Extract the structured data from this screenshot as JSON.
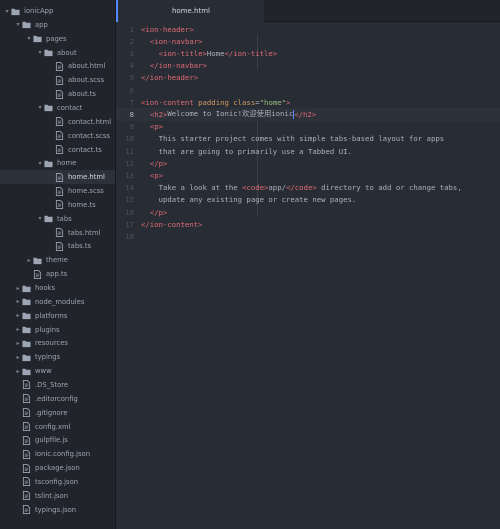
{
  "tab": {
    "title": "home.html"
  },
  "tree": [
    {
      "label": "ionicApp",
      "kind": "folder",
      "open": true,
      "depth": 0
    },
    {
      "label": "app",
      "kind": "folder",
      "open": true,
      "depth": 1
    },
    {
      "label": "pages",
      "kind": "folder",
      "open": true,
      "depth": 2
    },
    {
      "label": "about",
      "kind": "folder",
      "open": true,
      "depth": 3
    },
    {
      "label": "about.html",
      "kind": "file",
      "depth": 4
    },
    {
      "label": "about.scss",
      "kind": "file",
      "depth": 4
    },
    {
      "label": "about.ts",
      "kind": "file",
      "depth": 4
    },
    {
      "label": "contact",
      "kind": "folder",
      "open": true,
      "depth": 3
    },
    {
      "label": "contact.html",
      "kind": "file",
      "depth": 4
    },
    {
      "label": "contact.scss",
      "kind": "file",
      "depth": 4
    },
    {
      "label": "contact.ts",
      "kind": "file",
      "depth": 4
    },
    {
      "label": "home",
      "kind": "folder",
      "open": true,
      "depth": 3
    },
    {
      "label": "home.html",
      "kind": "file",
      "depth": 4,
      "selected": true
    },
    {
      "label": "home.scss",
      "kind": "file",
      "depth": 4
    },
    {
      "label": "home.ts",
      "kind": "file",
      "depth": 4
    },
    {
      "label": "tabs",
      "kind": "folder",
      "open": true,
      "depth": 3
    },
    {
      "label": "tabs.html",
      "kind": "file",
      "depth": 4
    },
    {
      "label": "tabs.ts",
      "kind": "file",
      "depth": 4
    },
    {
      "label": "theme",
      "kind": "folder",
      "open": false,
      "depth": 2
    },
    {
      "label": "app.ts",
      "kind": "file",
      "depth": 2
    },
    {
      "label": "hooks",
      "kind": "folder",
      "open": false,
      "depth": 1
    },
    {
      "label": "node_modules",
      "kind": "folder",
      "open": false,
      "depth": 1
    },
    {
      "label": "platforms",
      "kind": "folder",
      "open": false,
      "depth": 1
    },
    {
      "label": "plugins",
      "kind": "folder",
      "open": false,
      "depth": 1
    },
    {
      "label": "resources",
      "kind": "folder",
      "open": false,
      "depth": 1
    },
    {
      "label": "typings",
      "kind": "folder",
      "open": false,
      "depth": 1
    },
    {
      "label": "www",
      "kind": "folder",
      "open": false,
      "depth": 1
    },
    {
      "label": ".DS_Store",
      "kind": "file",
      "depth": 1
    },
    {
      "label": ".editorconfig",
      "kind": "file",
      "depth": 1
    },
    {
      "label": ".gitignore",
      "kind": "file",
      "depth": 1
    },
    {
      "label": "config.xml",
      "kind": "file",
      "depth": 1
    },
    {
      "label": "gulpfile.js",
      "kind": "file",
      "depth": 1
    },
    {
      "label": "ionic.config.json",
      "kind": "file",
      "depth": 1
    },
    {
      "label": "package.json",
      "kind": "file",
      "depth": 1
    },
    {
      "label": "tsconfig.json",
      "kind": "file",
      "depth": 1
    },
    {
      "label": "tslint.json",
      "kind": "file",
      "depth": 1
    },
    {
      "label": "typings.json",
      "kind": "file",
      "depth": 1
    }
  ],
  "editor": {
    "current_line": 8,
    "lines": [
      {
        "n": "1",
        "tokens": [
          {
            "c": "t-tag",
            "t": "<ion-header>"
          }
        ]
      },
      {
        "n": "2",
        "tokens": [
          {
            "c": "t-txt",
            "t": "  "
          },
          {
            "c": "t-tag",
            "t": "<ion-navbar>"
          }
        ]
      },
      {
        "n": "3",
        "tokens": [
          {
            "c": "t-txt",
            "t": "    "
          },
          {
            "c": "t-tag",
            "t": "<ion-title>"
          },
          {
            "c": "t-txt",
            "t": "Home"
          },
          {
            "c": "t-tag",
            "t": "</ion-title>"
          }
        ]
      },
      {
        "n": "4",
        "tokens": [
          {
            "c": "t-txt",
            "t": "  "
          },
          {
            "c": "t-tag",
            "t": "</ion-navbar>"
          }
        ]
      },
      {
        "n": "5",
        "tokens": [
          {
            "c": "t-tag",
            "t": "</ion-header>"
          }
        ]
      },
      {
        "n": "6",
        "tokens": []
      },
      {
        "n": "7",
        "tokens": [
          {
            "c": "t-tag",
            "t": "<ion-content "
          },
          {
            "c": "t-attr",
            "t": "padding class"
          },
          {
            "c": "t-txt",
            "t": "="
          },
          {
            "c": "t-str",
            "t": "\"home\""
          },
          {
            "c": "t-tag",
            "t": ">"
          }
        ]
      },
      {
        "n": "8",
        "tokens": [
          {
            "c": "t-txt",
            "t": "  "
          },
          {
            "c": "t-tag",
            "t": "<h2>"
          },
          {
            "c": "t-txt",
            "t": "Welcome to Ionic!欢迎使用ionic"
          },
          {
            "c": "cursor",
            "t": ""
          },
          {
            "c": "t-tag",
            "t": "</h2>"
          }
        ]
      },
      {
        "n": "9",
        "tokens": [
          {
            "c": "t-txt",
            "t": "  "
          },
          {
            "c": "t-tag",
            "t": "<p>"
          }
        ]
      },
      {
        "n": "10",
        "tokens": [
          {
            "c": "t-txt",
            "t": "    This starter project comes with simple tabs-based layout for apps"
          }
        ]
      },
      {
        "n": "11",
        "tokens": [
          {
            "c": "t-txt",
            "t": "    that are going to primarily use a Tabbed UI."
          }
        ]
      },
      {
        "n": "12",
        "tokens": [
          {
            "c": "t-txt",
            "t": "  "
          },
          {
            "c": "t-tag",
            "t": "</p>"
          }
        ]
      },
      {
        "n": "13",
        "tokens": [
          {
            "c": "t-txt",
            "t": "  "
          },
          {
            "c": "t-tag",
            "t": "<p>"
          }
        ]
      },
      {
        "n": "14",
        "tokens": [
          {
            "c": "t-txt",
            "t": "    Take a look at the "
          },
          {
            "c": "t-tag",
            "t": "<code>"
          },
          {
            "c": "t-txt",
            "t": "app/"
          },
          {
            "c": "t-tag",
            "t": "</code>"
          },
          {
            "c": "t-txt",
            "t": " directory to add or change tabs,"
          }
        ]
      },
      {
        "n": "15",
        "tokens": [
          {
            "c": "t-txt",
            "t": "    update any existing page or create new pages."
          }
        ]
      },
      {
        "n": "16",
        "tokens": [
          {
            "c": "t-txt",
            "t": "  "
          },
          {
            "c": "t-tag",
            "t": "</p>"
          }
        ]
      },
      {
        "n": "17",
        "tokens": [
          {
            "c": "t-tag",
            "t": "</ion-content>"
          }
        ]
      },
      {
        "n": "18",
        "tokens": []
      }
    ]
  }
}
